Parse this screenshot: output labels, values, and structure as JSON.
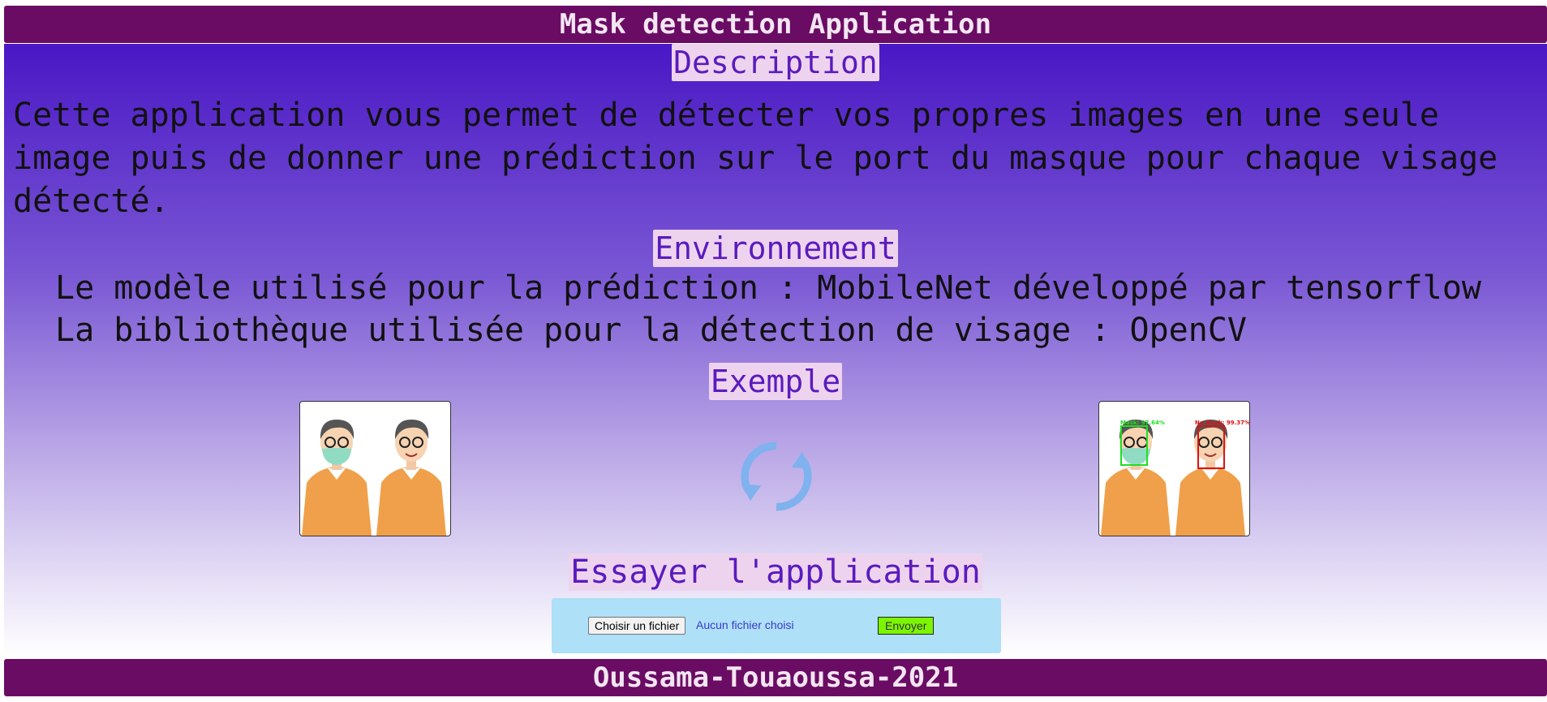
{
  "header": {
    "title": "Mask detection Application"
  },
  "description": {
    "title": "Description",
    "text": "Cette application vous permet de détecter vos propres images en une seule image puis de donner une prédiction sur le port du masque pour chaque visage détecté."
  },
  "environment": {
    "title": "Environnement",
    "lines": [
      "Le modèle utilisé pour la prédiction : MobileNet développé par tensorflow",
      "La bibliothèque utilisée pour la détection de visage : OpenCV"
    ]
  },
  "example": {
    "title": "Exemple",
    "input_image": "two-men-one-masked-illustration",
    "output_image": "two-men-with-detection-boxes-illustration",
    "transition_icon": "refresh-icon",
    "detections": [
      {
        "label": "Mask: 97.64%",
        "color": "#22dd22"
      },
      {
        "label": "No Mask: 99.37%",
        "color": "#e01010"
      }
    ]
  },
  "try_app": {
    "title": "Essayer l'application",
    "file_button": "Choisir un fichier",
    "file_status": "Aucun fichier choisi",
    "submit_button": "Envoyer"
  },
  "footer": {
    "text": "Oussama-Touaoussa-2021"
  },
  "colors": {
    "bar": "#6a0c63",
    "gradient_top": "#4a17c5",
    "title_bg": "#eed3ef",
    "title_text": "#5a1bbd",
    "upload_bg": "#aee0f8",
    "submit_bg": "#7cf600"
  }
}
